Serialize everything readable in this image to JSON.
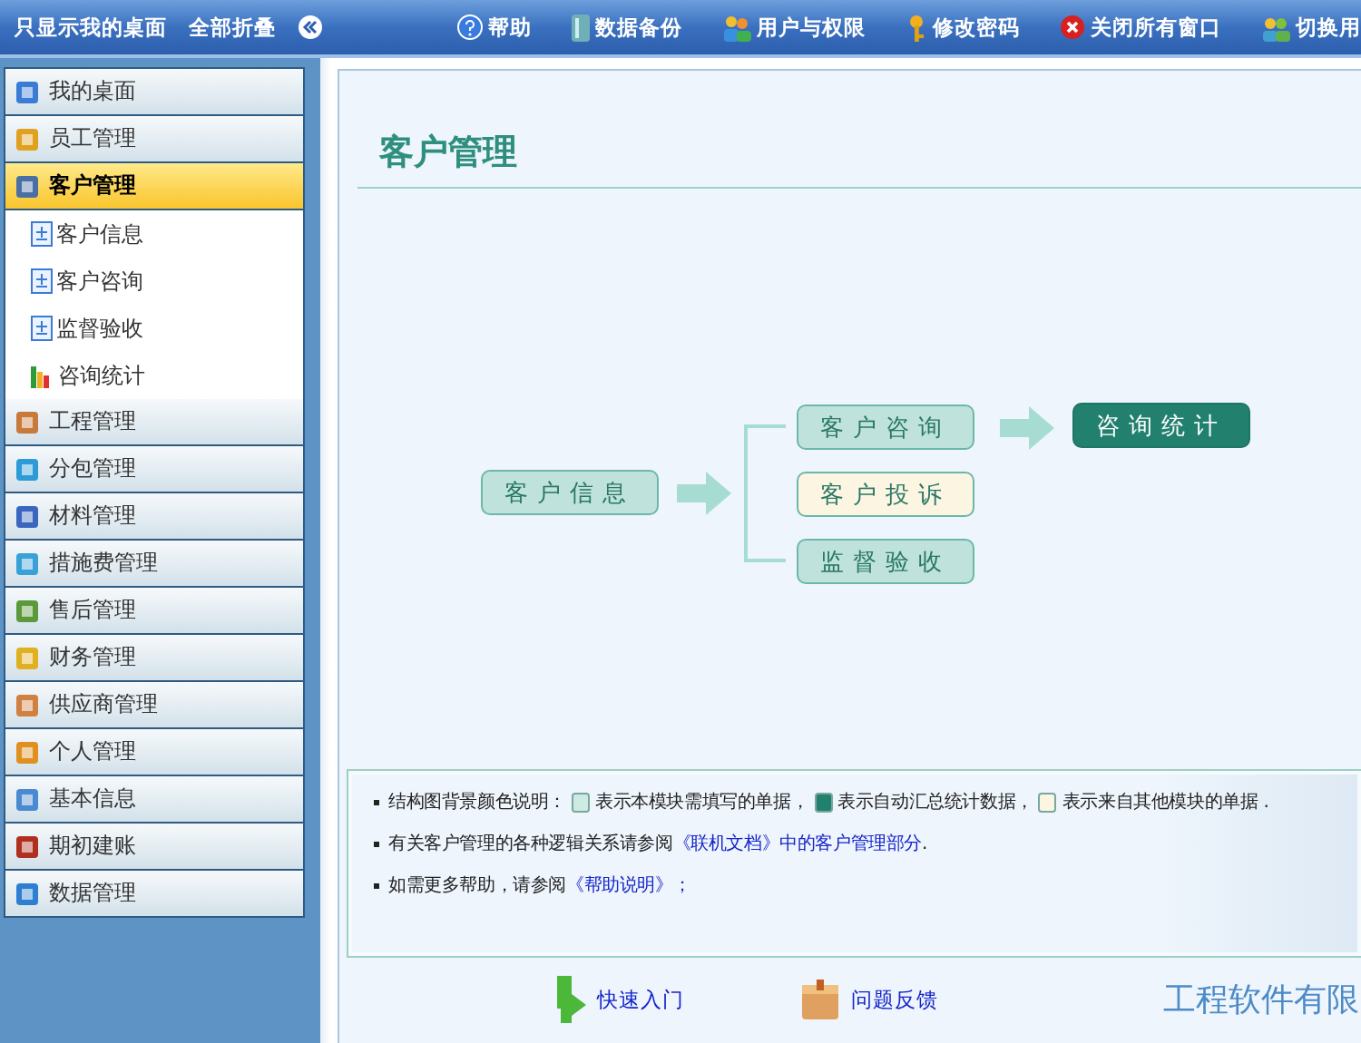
{
  "top_bar": {
    "left": [
      {
        "kind": "link",
        "label": "只显示我的桌面"
      },
      {
        "kind": "link",
        "label": "全部折叠"
      },
      {
        "kind": "collapse"
      }
    ],
    "right": [
      {
        "label": "帮助"
      },
      {
        "label": "数据备份"
      },
      {
        "label": "用户与权限"
      },
      {
        "label": "修改密码"
      },
      {
        "label": "关闭所有窗口"
      },
      {
        "label": "切换用"
      }
    ]
  },
  "sidebar": {
    "items": [
      {
        "label": "我的桌面",
        "selected": false
      },
      {
        "label": "员工管理",
        "selected": false
      },
      {
        "label": "客户管理",
        "selected": true,
        "expanded": true,
        "children": [
          {
            "label": "客户信息"
          },
          {
            "label": "客户咨询"
          },
          {
            "label": "监督验收"
          },
          {
            "label": "咨询统计"
          }
        ]
      },
      {
        "label": "工程管理",
        "selected": false
      },
      {
        "label": "分包管理",
        "selected": false
      },
      {
        "label": "材料管理",
        "selected": false
      },
      {
        "label": "措施费管理",
        "selected": false
      },
      {
        "label": "售后管理",
        "selected": false
      },
      {
        "label": "财务管理",
        "selected": false
      },
      {
        "label": "供应商管理",
        "selected": false
      },
      {
        "label": "个人管理",
        "selected": false
      },
      {
        "label": "基本信息",
        "selected": false
      },
      {
        "label": "期初建账",
        "selected": false
      },
      {
        "label": "数据管理",
        "selected": false
      }
    ]
  },
  "content": {
    "title": "客户管理",
    "diagram": {
      "nodes": [
        {
          "label": "客户信息",
          "kind": "fill"
        },
        {
          "label": "客户咨询",
          "kind": "fill"
        },
        {
          "label": "客户投诉",
          "kind": "other"
        },
        {
          "label": "监督验收",
          "kind": "fill"
        },
        {
          "label": "咨询统计",
          "kind": "auto"
        }
      ]
    },
    "legend": [
      {
        "parts": [
          {
            "kind": "text",
            "text": "结构图背景颜色说明："
          },
          {
            "kind": "swatch",
            "color": "#cfe9e3"
          },
          {
            "kind": "text",
            "text": "表示本模块需填写的单据，"
          },
          {
            "kind": "swatch",
            "color": "#22806f"
          },
          {
            "kind": "text",
            "text": "表示自动汇总统计数据，"
          },
          {
            "kind": "swatch",
            "color": "#fbf5e2"
          },
          {
            "kind": "text",
            "text": "表示来自其他模块的单据 ."
          }
        ]
      },
      {
        "parts": [
          {
            "kind": "text",
            "text": "有关客户管理的各种逻辑关系请参阅"
          },
          {
            "kind": "link",
            "text": "《联机文档》中的客户管理部分"
          },
          {
            "kind": "text",
            "text": " ."
          }
        ]
      },
      {
        "parts": [
          {
            "kind": "text",
            "text": "如需更多帮助，请参阅"
          },
          {
            "kind": "link",
            "text": "《帮助说明》；"
          }
        ]
      }
    ],
    "footer_links": [
      {
        "label": "快速入门"
      },
      {
        "label": "问题反馈"
      }
    ],
    "company": "工程软件有限"
  }
}
